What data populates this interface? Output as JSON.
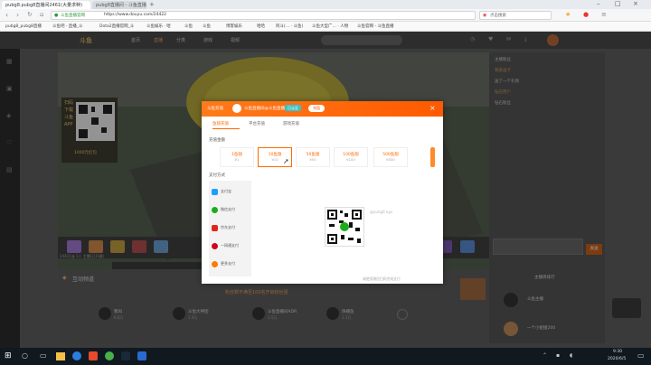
{
  "browser": {
    "tabs": [
      {
        "title": "pubg8.pubg8直播间2461(大量求种)",
        "active": true
      },
      {
        "title": "pubg8直播间 - 斗鱼直播",
        "active": false
      }
    ],
    "address": "https://www.douyu.com/24422",
    "address_lock_text": "斗鱼直播官网",
    "search_label": "点击搜索",
    "bookmarks": [
      "pubg8_pubg8直播",
      "斗鱼吧 · 直播_斗",
      "Dota2直播官网_斗",
      "斗鱼娱乐 · 哈",
      "斗鱼",
      "斗鱼",
      "博客娱乐",
      "哈哈",
      "阿斗(… · 斗鱼)",
      "斗鱼大型广… · 人物",
      "斗鱼官网 - 斗鱼直播"
    ]
  },
  "site": {
    "logo": "斗鱼",
    "nav": [
      "首页",
      "直播",
      "分类",
      "游戏",
      "视频"
    ],
    "qr_promo_lines": [
      "扫码下载",
      "斗鱼APP",
      "万元豪礼等你",
      "1000元红包"
    ],
    "stream_info": "24421@ 1人 主播(已开通)",
    "section_title": "互动频道",
    "banner": "粉丝数不满至100名开启粉丝团",
    "cards": [
      {
        "name": "我叫",
        "sub": "6.8万"
      },
      {
        "name": "斗鱼大神团",
        "sub": "1.9万"
      },
      {
        "name": "斗鱼直播间ADR",
        "sub": "3.5万"
      },
      {
        "name": "快播鱼",
        "sub": "1.1万"
      }
    ],
    "right_panel": {
      "title": "主播周排行",
      "rank_items": [
        "斗鱼主播",
        "一个小姐姐200"
      ],
      "chat_tags": [
        "主播粉丝",
        "我来送卡",
        "送了一个礼物",
        "钻石用户",
        "钻石粉丝"
      ],
      "send_label": "发送"
    }
  },
  "modal": {
    "header_title": "斗鱼充值",
    "header_user": "斗鱼直播间@斗鱼直播",
    "header_badge": "已认证",
    "header_link": "充值",
    "tabs": [
      "鱼翅充值",
      "平台充值",
      "游戏充值"
    ],
    "amount_label": "充值金额",
    "amounts": [
      {
        "top": "1鱼翅",
        "bottom": "¥1"
      },
      {
        "top": "10鱼翅",
        "bottom": "¥10"
      },
      {
        "top": "50鱼翅",
        "bottom": "¥50"
      },
      {
        "top": "100鱼翅",
        "bottom": "¥100"
      },
      {
        "top": "500鱼翅",
        "bottom": "¥500"
      }
    ],
    "method_label": "支付方式",
    "payments": [
      {
        "label": "支付宝",
        "color": "#1a9fff"
      },
      {
        "label": "微信支付",
        "color": "#1aad19"
      },
      {
        "label": "京东支付",
        "color": "#e1251b"
      },
      {
        "label": "一网通支付",
        "color": "#d0021b"
      },
      {
        "label": "更多支付",
        "color": "#ff7a00"
      }
    ],
    "qr_hint": "@pubg8 kgx",
    "footer": "请使用微信扫码完成支付"
  },
  "taskbar": {
    "time": "9:30",
    "date": "2020/6/5"
  }
}
